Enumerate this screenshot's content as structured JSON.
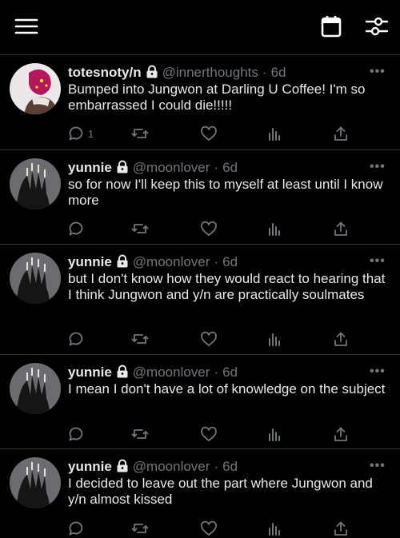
{
  "header": {
    "menu_icon": "hamburger-icon",
    "calendar_icon": "calendar-icon",
    "filter_icon": "sliders-icon"
  },
  "tweets": [
    {
      "name": "totesnoty/n",
      "handle": "@innerthoughts",
      "time": "6d",
      "text": "Bumped into Jungwon at Darling U Coffee! I'm so embarrassed I could die!!!!!",
      "reply_count": "1"
    },
    {
      "name": "yunnie",
      "handle": "@moonlover",
      "time": "6d",
      "text": "so for now I'll keep this to myself at least until I know more",
      "reply_count": ""
    },
    {
      "name": "yunnie",
      "handle": "@moonlover",
      "time": "6d",
      "text": "but I don't know how they would react to hearing that I think Jungwon and y/n are practically soulmates",
      "reply_count": ""
    },
    {
      "name": "yunnie",
      "handle": "@moonlover",
      "time": "6d",
      "text": "I mean I don't have a lot of knowledge on the subject",
      "reply_count": ""
    },
    {
      "name": "yunnie",
      "handle": "@moonlover",
      "time": "6d",
      "text": "I decided to leave out the part where Jungwon and y/n almost kissed",
      "reply_count": ""
    }
  ],
  "meta": {
    "time_separator": "·",
    "more_glyph": "•••"
  }
}
